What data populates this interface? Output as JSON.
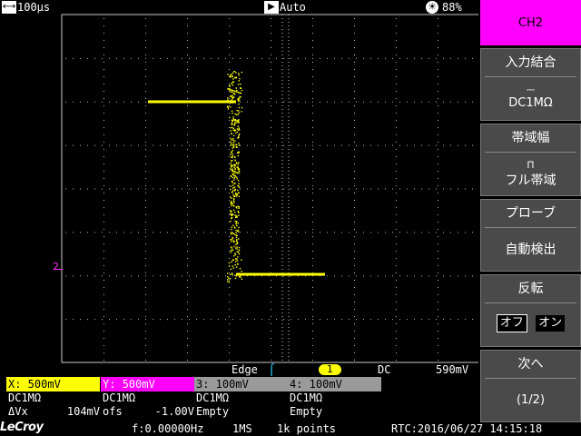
{
  "top": {
    "timebase": "100μs",
    "trigger_mode": "Auto",
    "battery": "88%"
  },
  "trigger": {
    "source": "Edge",
    "channel": "1",
    "coupling": "DC",
    "level": "590mV"
  },
  "channels": [
    {
      "head": "X: 500mV",
      "line1": "DC1MΩ",
      "line2_left": "ΔVx",
      "line2_right": "104mV",
      "color": "#ffff00",
      "text_color": "#000000"
    },
    {
      "head": "Y: 500mV",
      "line1": "DC1MΩ",
      "line2_left": "ofs",
      "line2_right": "-1.00V",
      "color": "#ff00ff",
      "text_color": "#ffffff"
    },
    {
      "head": "3: 100mV",
      "line1": "DC1MΩ",
      "line2_left": "Empty",
      "line2_right": "",
      "color": "#9a9a9a",
      "text_color": "#000000"
    },
    {
      "head": "4: 100mV",
      "line1": "DC1MΩ",
      "line2_left": "Empty",
      "line2_right": "",
      "color": "#9a9a9a",
      "text_color": "#000000"
    }
  ],
  "bottom": {
    "logo": "LeCroy",
    "frequency": "f:0.00000Hz",
    "sample_rate": "1MS",
    "points": "1k points",
    "rtc": "RTC:2016/06/27 14:15:18"
  },
  "menu": {
    "channel": "CH2",
    "input_coupling_label": "入力結合",
    "input_coupling_value": "DC1MΩ",
    "bandwidth_label": "帯域幅",
    "bandwidth_value": "フル帯域",
    "probe_label": "プローブ",
    "probe_value": "自動検出",
    "invert_label": "反転",
    "invert_off": "オフ",
    "invert_on": "オン",
    "next_label": "次へ",
    "page": "(1/2)"
  },
  "colors": {
    "trace": "#ffff00",
    "ch2": "#ff00ff",
    "menu_bg": "#4a4a4a"
  }
}
